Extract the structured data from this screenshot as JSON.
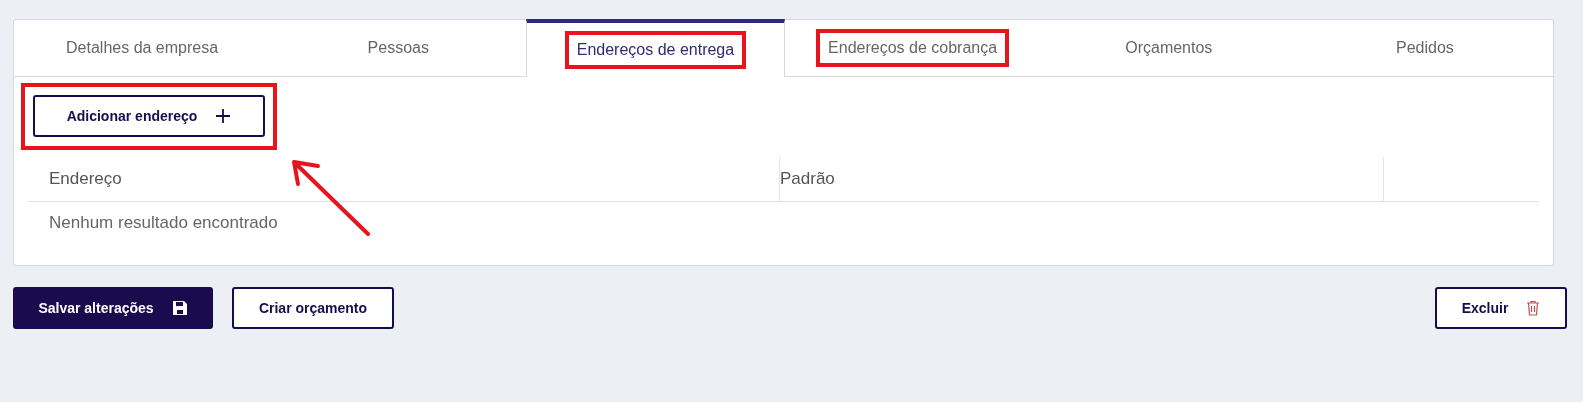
{
  "tabs": [
    {
      "label": "Detalhes da empresa",
      "selected": false,
      "highlighted": false
    },
    {
      "label": "Pessoas",
      "selected": false,
      "highlighted": false
    },
    {
      "label": "Endereços de entrega",
      "selected": true,
      "highlighted": true
    },
    {
      "label": "Endereços de cobrança",
      "selected": false,
      "highlighted": true
    },
    {
      "label": "Orçamentos",
      "selected": false,
      "highlighted": false
    },
    {
      "label": "Pedidos",
      "selected": false,
      "highlighted": false
    }
  ],
  "add_button": {
    "label": "Adicionar endereço",
    "highlighted": true
  },
  "table": {
    "columns": [
      "Endereço",
      "Padrão"
    ],
    "empty_message": "Nenhum resultado encontrado"
  },
  "actions": {
    "save": "Salvar alterações",
    "create_quote": "Criar orçamento",
    "delete": "Excluir"
  }
}
